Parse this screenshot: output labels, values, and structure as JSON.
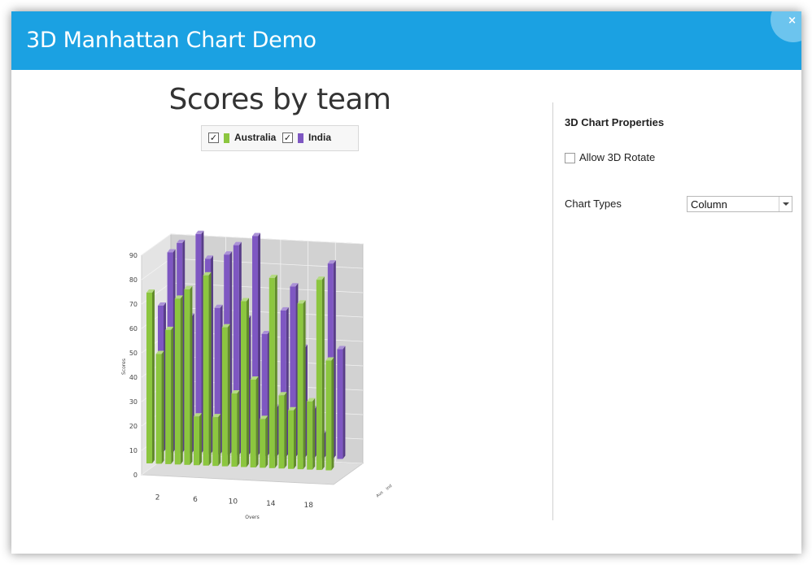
{
  "window": {
    "title": "3D Manhattan Chart Demo",
    "close_glyph": "×"
  },
  "colors": {
    "titlebar": "#1ba1e2",
    "australia": "#8cc63f",
    "india": "#7e57c2"
  },
  "chart_data": {
    "type": "bar",
    "title": "Scores by team",
    "xlabel": "Overs",
    "ylabel": "Scores",
    "ylim": [
      0,
      90
    ],
    "y_ticks": [
      0,
      10,
      20,
      30,
      40,
      50,
      60,
      70,
      80,
      90
    ],
    "x_ticks": [
      2,
      6,
      10,
      14,
      18
    ],
    "depth_ticks": [
      "Aus",
      "Ind"
    ],
    "legend_position": "top",
    "grid": true,
    "x": [
      1,
      2,
      3,
      4,
      5,
      6,
      7,
      8,
      9,
      10,
      11,
      12,
      13,
      14,
      15,
      16,
      17,
      18,
      19,
      20
    ],
    "series": [
      {
        "name": "Australia",
        "values": [
          70,
          45,
          55,
          68,
          72,
          20,
          78,
          20,
          57,
          30,
          68,
          36,
          20,
          78,
          30,
          24,
          68,
          28,
          78,
          45
        ]
      },
      {
        "name": "India",
        "values": [
          60,
          82,
          86,
          56,
          98,
          80,
          60,
          82,
          86,
          56,
          98,
          50,
          20,
          60,
          70,
          45,
          20,
          10,
          80,
          45
        ]
      }
    ]
  },
  "legend": {
    "check_glyph": "✓"
  },
  "properties": {
    "heading": "3D Chart Properties",
    "allow_rotate_label": "Allow 3D Rotate",
    "allow_rotate_checked": false,
    "chart_types_label": "Chart Types",
    "chart_type_value": "Column"
  }
}
